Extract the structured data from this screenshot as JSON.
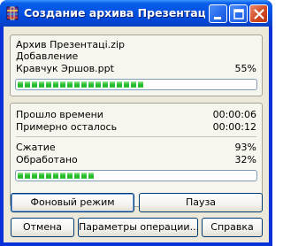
{
  "window": {
    "title": "Создание архива Презентаці....",
    "title_color": "#0554e3"
  },
  "icons": {
    "app": "winrar-archive-icon",
    "minimize": "minimize-icon",
    "maximize": "maximize-icon",
    "close": "close-icon"
  },
  "file_info": {
    "archive_name": "Архив Презентаці.zip",
    "operation": "Добавление",
    "current_file": "Кравчук Эршов.ppt",
    "file_percent": "55%",
    "file_progress": 0.55
  },
  "timing": {
    "elapsed_label": "Прошло времени",
    "elapsed_value": "00:00:06",
    "remaining_label": "Примерно осталось",
    "remaining_value": "00:00:12"
  },
  "stats": {
    "compression_label": "Сжатие",
    "compression_value": "93%",
    "processed_label": "Обработано",
    "processed_value": "32%",
    "total_progress": 0.32
  },
  "buttons": {
    "background": "Фоновый режим",
    "pause": "Пауза",
    "cancel": "Отмена",
    "options": "Параметры операции...",
    "help": "Справка"
  },
  "colors": {
    "progress_green": "#23b027",
    "face": "#ece9d8"
  }
}
